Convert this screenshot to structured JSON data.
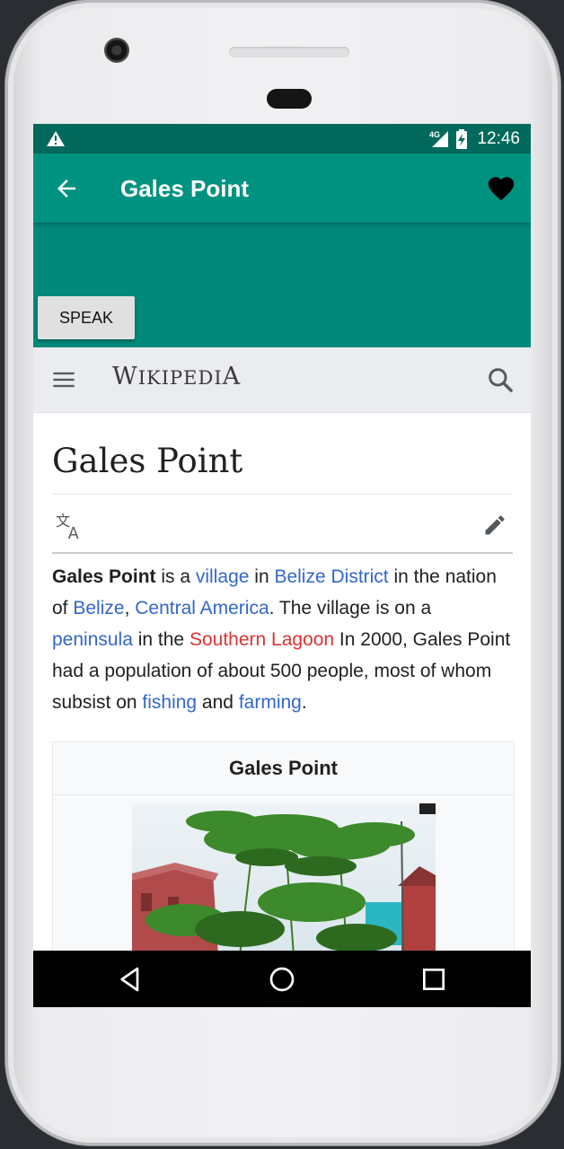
{
  "status_bar": {
    "time": "12:46",
    "network": "4G",
    "icons": [
      "warning-icon",
      "signal-icon",
      "battery-charging-icon"
    ]
  },
  "toolbar": {
    "title": "Gales Point",
    "icons": [
      "back-arrow-icon",
      "heart-icon"
    ]
  },
  "speak_button": {
    "label": "SPEAK"
  },
  "wiki_header": {
    "logo_parts": [
      "W",
      "IKIPEDI",
      "A"
    ],
    "icons": [
      "menu-icon",
      "search-icon"
    ]
  },
  "article": {
    "title": "Gales Point",
    "icons": [
      "translate-icon",
      "edit-pencil-icon"
    ],
    "lead": {
      "bold": "Gales Point",
      "t1": " is a ",
      "link_village": "village",
      "t2": " in ",
      "link_belize_district": "Belize District",
      "t3": " in the nation of ",
      "link_belize": "Belize",
      "t4": ", ",
      "link_central_america": "Central America",
      "t5": ". The village is on a ",
      "link_peninsula": "peninsula",
      "t6": " in the ",
      "link_southern_lagoon": "Southern Lagoon",
      "t7": " In 2000, Gales Point had a population of about 500 people, most of whom subsist on ",
      "link_fishing": "fishing",
      "t8": " and ",
      "link_farming": "farming",
      "t9": "."
    },
    "infobox": {
      "title": "Gales Point"
    }
  },
  "colors": {
    "status_bar": "#00695c",
    "toolbar": "#009280",
    "header_area": "#00897b",
    "link": "#3366cc",
    "redlink": "#dd3333"
  },
  "nav_bar": {
    "icons": [
      "nav-back-icon",
      "nav-home-icon",
      "nav-recents-icon"
    ]
  }
}
